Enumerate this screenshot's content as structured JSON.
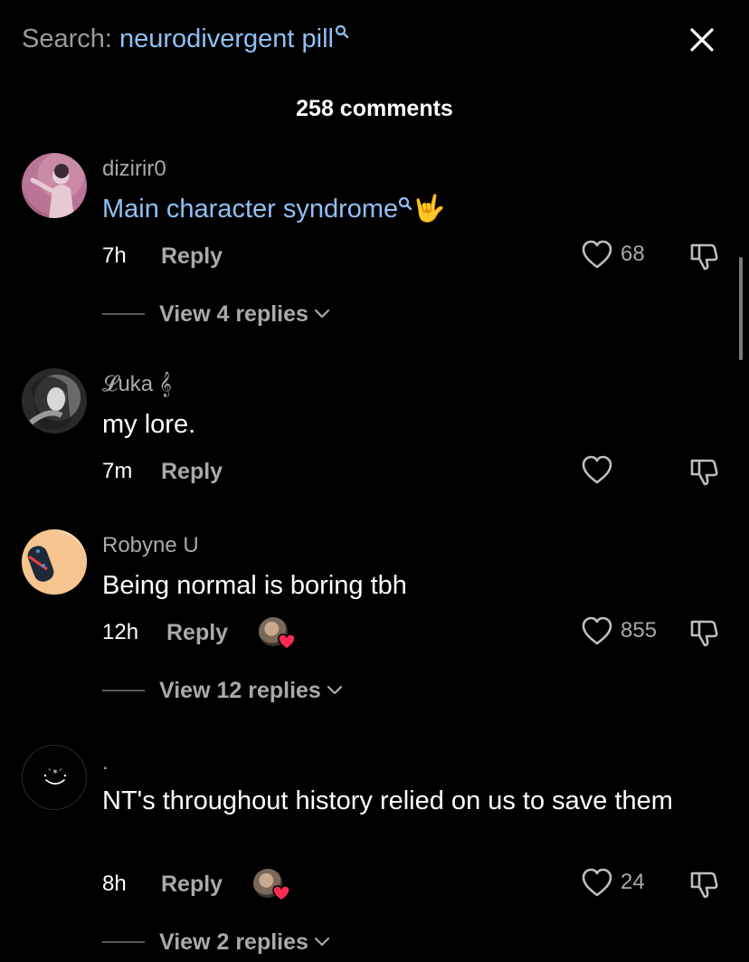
{
  "search": {
    "label": "Search:",
    "term": "neurodivergent pill"
  },
  "comments_header": {
    "count_text": "258 comments"
  },
  "comments": [
    {
      "username": "dizirir0",
      "text": "Main character syndrome",
      "emoji": "🤟",
      "time": "7h",
      "reply_label": "Reply",
      "likes": "68",
      "view_replies": "View 4 replies"
    },
    {
      "username": "𝓛uka 𝄞",
      "text": "my lore.",
      "time": "7m",
      "reply_label": "Reply",
      "likes": ""
    },
    {
      "username": "Robyne U",
      "text": "Being normal is boring tbh",
      "time": "12h",
      "reply_label": "Reply",
      "likes": "855",
      "view_replies": "View 12 replies"
    },
    {
      "username": ".",
      "text": "NT's throughout history relied on us to save them",
      "time": "8h",
      "reply_label": "Reply",
      "likes": "24",
      "view_replies": "View 2 replies"
    }
  ],
  "colors": {
    "background": "#000000",
    "link": "#8fc0f5",
    "muted": "#a9a9a9",
    "heart": "#fe2c55"
  },
  "icons": [
    "search-icon",
    "close-icon",
    "heart-icon",
    "dislike-icon",
    "chevron-down-icon",
    "creator-liked-icon"
  ]
}
